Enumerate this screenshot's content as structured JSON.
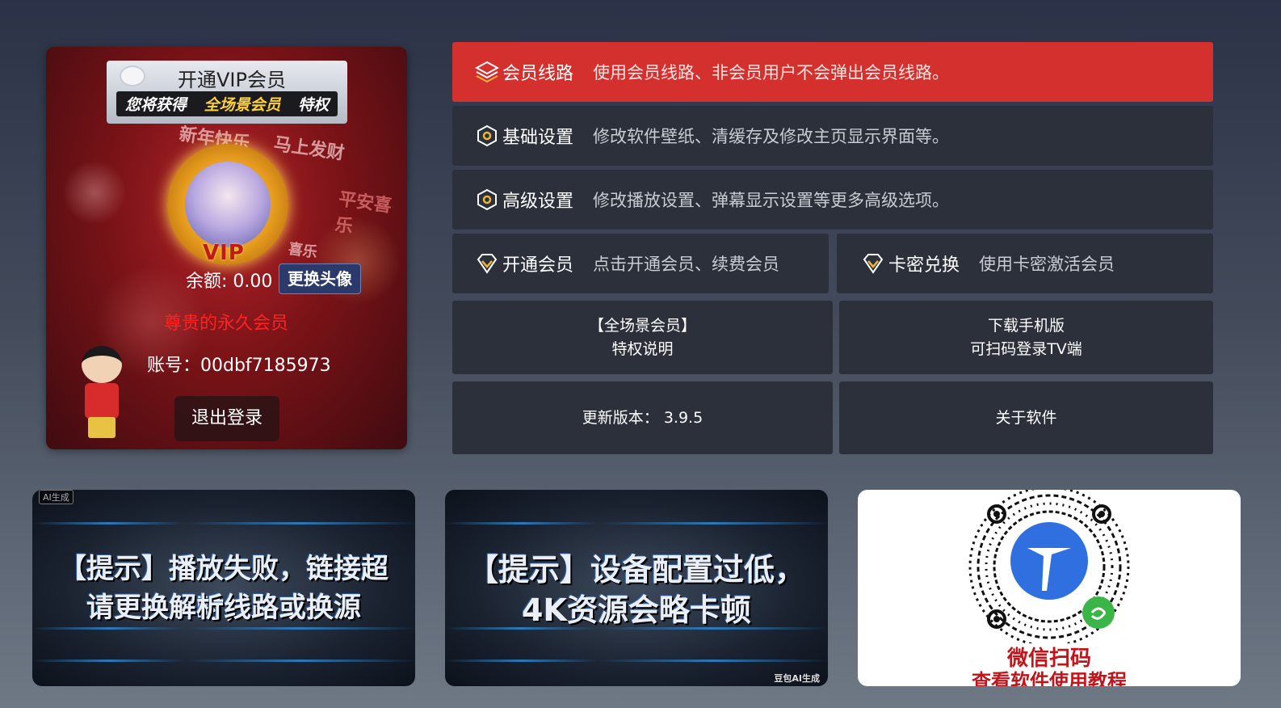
{
  "profile": {
    "vip_banner": {
      "title": "开通VIP会员",
      "strip_left": "您将获得",
      "strip_mid": "全场景会员",
      "strip_right": "特权"
    },
    "decorations": [
      "新年快乐",
      "马上发财",
      "平安喜乐",
      "喜乐"
    ],
    "vip_badge": "VIP",
    "balance": "余额: 0.00",
    "change_avatar_button": "更换头像",
    "member_status": "尊贵的永久会员",
    "account": "账号：00dbf7185973",
    "logout_button": "退出登录"
  },
  "menu": [
    {
      "title": "会员线路",
      "desc": "使用会员线路、非会员用户不会弹出会员线路。",
      "icon": "layers-icon",
      "active": true
    },
    {
      "title": "基础设置",
      "desc": "修改软件壁纸、清缓存及修改主页显示界面等。",
      "icon": "hexagon-icon"
    },
    {
      "title": "高级设置",
      "desc": "修改播放设置、弹幕显示设置等更多高级选项。",
      "icon": "hexagon-icon"
    }
  ],
  "vip_actions": [
    {
      "title": "开通会员",
      "desc": "点击开通会员、续费会员",
      "icon": "diamond-icon"
    },
    {
      "title": "卡密兑换",
      "desc": "使用卡密激活会员",
      "icon": "diamond-icon"
    }
  ],
  "tiles": {
    "privilege_line1": "【全场景会员】",
    "privilege_line2": "特权说明",
    "download_line1": "下载手机版",
    "download_line2": "可扫码登录TV端",
    "version": "更新版本： 3.9.5",
    "about": "关于软件"
  },
  "cards": {
    "tip1_line1": "【提示】播放失败，链接超时，",
    "tip1_line2": "请更换解析线路或换源",
    "tip1_tag": "AI生成",
    "tip2_line1": "【提示】设备配置过低，",
    "tip2_line2": "4K资源会略卡顿",
    "tip2_tag": "豆包AI生成",
    "qr_line1": "微信扫码",
    "qr_line2": "查看软件使用教程"
  },
  "colors": {
    "active_row": "#d3302e",
    "row_bg": "#2b303a",
    "accent_gold": "#f0b33a",
    "member_red": "#ff2222"
  }
}
